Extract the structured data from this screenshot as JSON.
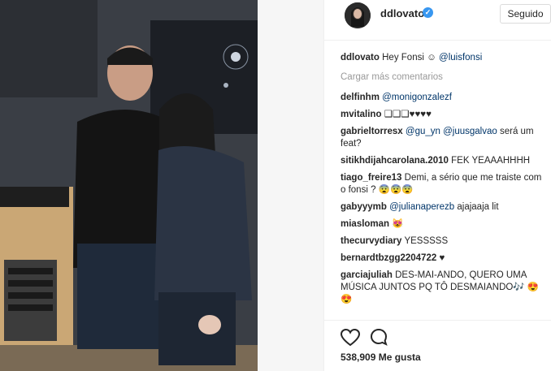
{
  "post": {
    "username": "ddlovato",
    "follow_label": "Seguido",
    "caption_user": "ddlovato",
    "caption_text": "Hey Fonsi ☺ ",
    "caption_mention": "@luisfonsi",
    "load_more": "Cargar más comentarios",
    "likes": "538,909 Me gusta"
  },
  "comments": [
    {
      "user": "delfinhm",
      "mention": "@monigonzalezf",
      "text": ""
    },
    {
      "user": "mvitalino",
      "mention": "",
      "text": "❑❑❑♥♥♥♥"
    },
    {
      "user": "gabrieltorresx",
      "mention": "@gu_yn @juusgalvao",
      "text": " será um feat?"
    },
    {
      "user": "sitikhdijahcarolana.2010",
      "mention": "",
      "text": "FEK YEAAAHHHH"
    },
    {
      "user": "tiago_freire13",
      "mention": "",
      "text": "Demi, a sério que me traiste com o fonsi ? 😨😨😨"
    },
    {
      "user": "gabyyymb",
      "mention": "@julianaperezb",
      "text": " ajajaaja lit"
    },
    {
      "user": "miasloman",
      "mention": "",
      "text": "😻"
    },
    {
      "user": "thecurvydiary",
      "mention": "",
      "text": "YESSSSS"
    },
    {
      "user": "bernardtbzgg2204722",
      "mention": "",
      "text": "♥"
    },
    {
      "user": "garciajuliah",
      "mention": "",
      "text": "DES-MAI-ANDO, QUERO UMA MÚSICA JUNTOS PQ TÔ DESMAIANDO🎶 😍😍"
    }
  ],
  "icons": {
    "like": "heart-icon",
    "comment": "comment-icon",
    "verified": "verified-badge-icon"
  },
  "colors": {
    "mention": "#003569",
    "verified": "#3897f0",
    "muted": "#999999"
  }
}
